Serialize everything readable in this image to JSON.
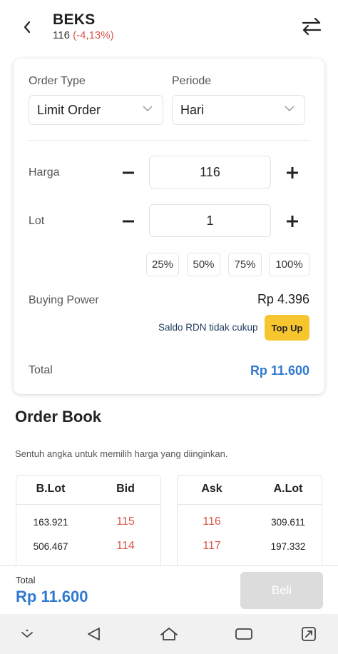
{
  "header": {
    "ticker": "BEKS",
    "price": "116",
    "change": "(-4,13%)"
  },
  "order_form": {
    "order_type_label": "Order Type",
    "order_type_value": "Limit Order",
    "periode_label": "Periode",
    "periode_value": "Hari",
    "harga_label": "Harga",
    "harga_value": "116",
    "lot_label": "Lot",
    "lot_value": "1",
    "percent_buttons": [
      "25%",
      "50%",
      "75%",
      "100%"
    ],
    "buying_power_label": "Buying Power",
    "buying_power_value": "Rp 4.396",
    "saldo_message": "Saldo RDN tidak cukup",
    "top_up_label": "Top Up",
    "total_label": "Total",
    "total_value": "Rp 11.600"
  },
  "order_book": {
    "title": "Order Book",
    "hint": "Sentuh angka untuk memilih harga yang diinginkan.",
    "bid_headers": [
      "B.Lot",
      "Bid"
    ],
    "ask_headers": [
      "Ask",
      "A.Lot"
    ],
    "bid_rows": [
      {
        "lot": "163.921",
        "price": "115"
      },
      {
        "lot": "506.467",
        "price": "114"
      }
    ],
    "ask_rows": [
      {
        "price": "116",
        "lot": "309.611"
      },
      {
        "price": "117",
        "lot": "197.332"
      }
    ]
  },
  "footer": {
    "total_label": "Total",
    "total_value": "Rp 11.600",
    "buy_label": "Beli"
  },
  "colors": {
    "accent_blue": "#2f7ad1",
    "negative_red": "#d9574b",
    "top_up_yellow": "#f7c62f",
    "disabled_grey": "#dcdcdc"
  },
  "icons": {
    "back": "chevron-left-icon",
    "swap": "swap-arrows-icon",
    "dropdown": "chevron-down-icon",
    "minus": "minus-icon",
    "plus": "plus-icon",
    "nav": [
      "collapse-down-icon",
      "back-triangle-icon",
      "home-icon",
      "recents-icon",
      "screenshot-icon"
    ]
  }
}
